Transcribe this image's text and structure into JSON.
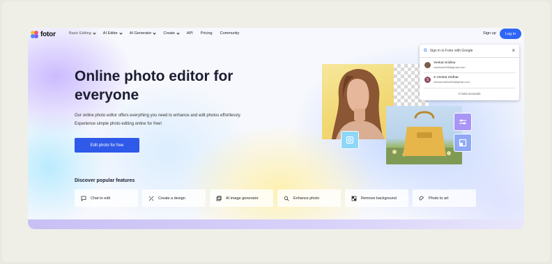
{
  "nav": {
    "logo_text": "fotor",
    "items": [
      {
        "label": "Basic Editing",
        "dropdown": true
      },
      {
        "label": "AI Editor",
        "dropdown": true
      },
      {
        "label": "AI Generator",
        "dropdown": true
      },
      {
        "label": "Create",
        "dropdown": true
      },
      {
        "label": "API",
        "dropdown": false
      },
      {
        "label": "Pricing",
        "dropdown": false
      },
      {
        "label": "Community",
        "dropdown": false
      }
    ],
    "signup_label": "Sign up",
    "login_label": "Log in"
  },
  "hero": {
    "headline": "Online photo editor for everyone",
    "subtext_line1": "Our online photo editor offers everything you need to enhance and edit photos effortlessly.",
    "subtext_line2": "Experience simple photo editing online for free!",
    "cta_label": "Edit photo for free"
  },
  "features": {
    "heading": "Discover popular features",
    "items": [
      {
        "label": "Chat to edit",
        "icon": "chat-icon"
      },
      {
        "label": "Create a design",
        "icon": "design-icon"
      },
      {
        "label": "AI image generator",
        "icon": "ai-image-icon"
      },
      {
        "label": "Enhance photo",
        "icon": "enhance-icon"
      },
      {
        "label": "Remove background",
        "icon": "remove-bg-icon"
      },
      {
        "label": "Photo to art",
        "icon": "art-icon"
      }
    ]
  },
  "google_popup": {
    "title": "Sign in to Fotor with Google",
    "accounts": [
      {
        "name": "Venkat Sridhar",
        "email": "vsridhar2006@gmail.com",
        "initial": ""
      },
      {
        "name": "S Venkat Sridhar",
        "email": "venkat.sridhar96@gmail.com",
        "initial": "S"
      }
    ],
    "more_label": "2 more accounts"
  },
  "colors": {
    "accent": "#2f59e8",
    "login_button": "#2f66f6",
    "google_blue": "#4285f4"
  }
}
